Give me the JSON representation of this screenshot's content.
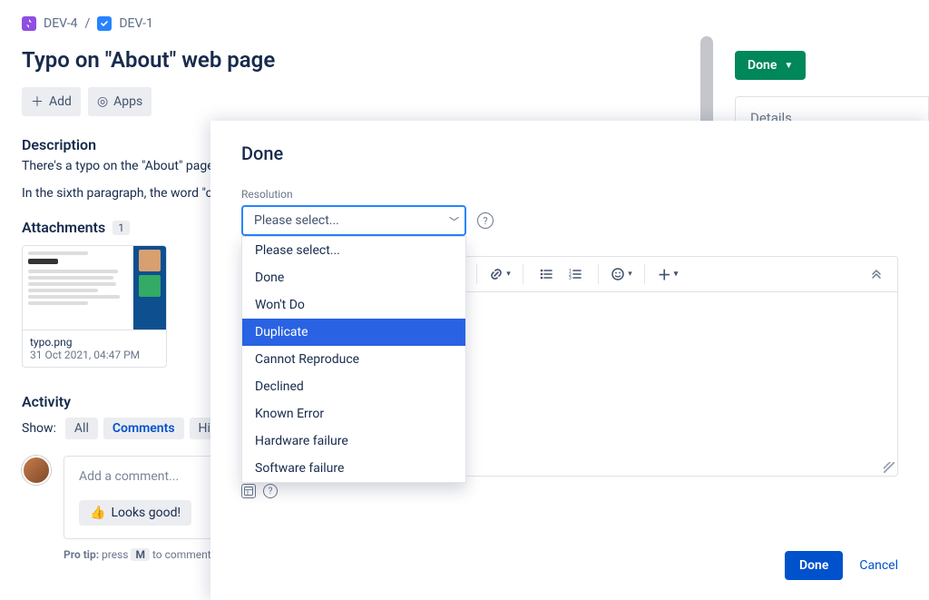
{
  "breadcrumbs": {
    "parent_key": "DEV-4",
    "sep": "/",
    "issue_key": "DEV-1"
  },
  "issue": {
    "title": "Typo on \"About\" web page"
  },
  "actions": {
    "add": "Add",
    "apps": "Apps"
  },
  "description": {
    "heading": "Description",
    "line1": "There's a typo on the \"About\" page",
    "line2": "In the sixth paragraph, the word \"cu"
  },
  "attachments": {
    "heading": "Attachments",
    "count": "1",
    "item": {
      "filename": "typo.png",
      "datetime": "31 Oct 2021, 04:47 PM"
    }
  },
  "activity": {
    "heading": "Activity",
    "show_label": "Show:",
    "tabs": {
      "all": "All",
      "comments": "Comments",
      "history": "Histor"
    }
  },
  "comment": {
    "placeholder": "Add a comment...",
    "chip": "Looks good!",
    "pro_tip_prefix": "Pro tip:",
    "pro_tip_mid": " press ",
    "pro_tip_key": "M",
    "pro_tip_suffix": " to comment"
  },
  "right": {
    "status": "Done",
    "details": "Details"
  },
  "modal": {
    "title": "Done",
    "resolution_label": "Resolution",
    "select_value": "Please select...",
    "options": {
      "o0": "Please select...",
      "o1": "Done",
      "o2": "Won't Do",
      "o3": "Duplicate",
      "o4": "Cannot Reproduce",
      "o5": "Declined",
      "o6": "Known Error",
      "o7": "Hardware failure",
      "o8": "Software failure"
    },
    "highlighted_option": "Duplicate",
    "footer": {
      "done": "Done",
      "cancel": "Cancel"
    }
  }
}
